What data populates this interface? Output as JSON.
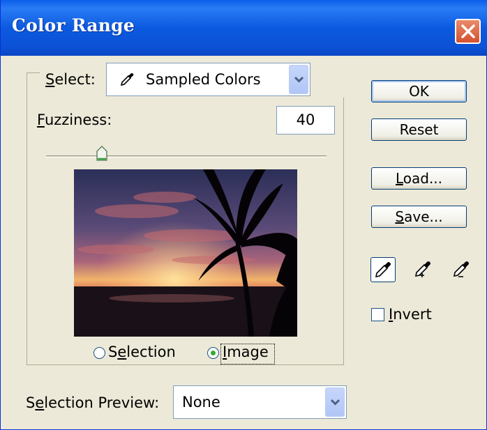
{
  "window": {
    "title": "Color Range"
  },
  "select": {
    "label_prefix": "",
    "label_accel": "S",
    "label_rest": "elect:",
    "value": "Sampled Colors",
    "eyedropper_icon": "eyedropper-icon"
  },
  "fuzziness": {
    "label_accel": "F",
    "label_rest": "uzziness:",
    "value": "40",
    "slider_fraction": 0.2
  },
  "preview_mode": {
    "selection": {
      "label_pre": "S",
      "label_accel": "e",
      "label_rest": "lection",
      "selected": false
    },
    "image": {
      "label_accel": "I",
      "label_rest": "mage",
      "selected": true
    }
  },
  "buttons": {
    "ok": "OK",
    "reset": "Reset",
    "load_accel": "L",
    "load_rest": "oad...",
    "save_accel": "S",
    "save_rest": "ave..."
  },
  "eyedroppers": [
    "eyedropper-icon",
    "add-to-sample-eyedropper-icon",
    "subtract-from-sample-eyedropper-icon"
  ],
  "invert": {
    "label_accel": "I",
    "label_rest": "nvert",
    "checked": false
  },
  "selection_preview": {
    "label_pre": "S",
    "label_accel": "e",
    "label_rest": "lection Preview:",
    "value": "None"
  }
}
